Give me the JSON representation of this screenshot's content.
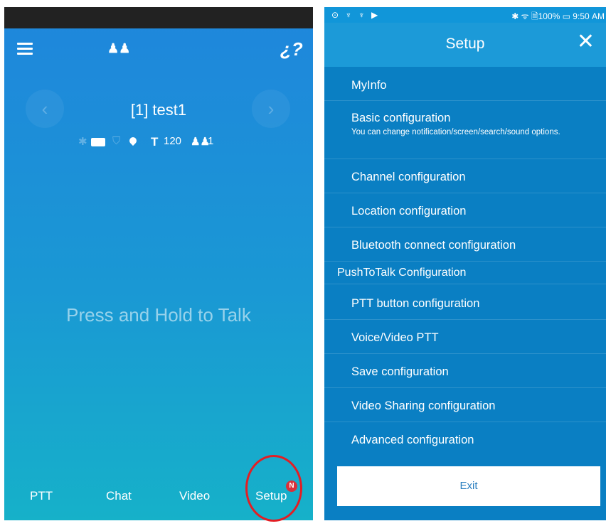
{
  "left": {
    "channel_title": "[1] test1",
    "talk_prompt": "Press and Hold to Talk",
    "status": {
      "text_icon": "T",
      "count_a": "120",
      "count_b": "1"
    },
    "tabs": [
      {
        "label": "PTT"
      },
      {
        "label": "Chat"
      },
      {
        "label": "Video"
      },
      {
        "label": "Setup"
      }
    ],
    "setup_badge": "N",
    "icons": [
      "menu-icon",
      "contacts-icon",
      "unlink-icon",
      "bluetooth-icon",
      "recorder-icon",
      "shield-icon",
      "location-icon",
      "text-icon",
      "group-icon",
      "chevron-left-icon",
      "chevron-right-icon"
    ],
    "colors": {
      "highlight_ring": "#e31e24",
      "badge": "#d8303a"
    }
  },
  "right": {
    "statusbar": {
      "left": "⊙ ♆ ♆ ▶",
      "right": "✱ ᯤ 🗎100% ▭ 9:50 AM"
    },
    "title": "Setup",
    "close_glyph": "✕",
    "items": [
      {
        "label": "MyInfo"
      },
      {
        "label": "Basic configuration",
        "sub": "You can change notification/screen/search/sound options."
      },
      {
        "label": "Channel configuration"
      },
      {
        "label": "Location configuration"
      },
      {
        "label": "Bluetooth connect configuration"
      }
    ],
    "section": "PushToTalk Configuration",
    "ptt_items": [
      {
        "label": "PTT button configuration"
      },
      {
        "label": "Voice/Video PTT"
      },
      {
        "label": "Save configuration"
      },
      {
        "label": "Video Sharing configuration"
      },
      {
        "label": "Advanced configuration"
      }
    ],
    "exit_label": "Exit",
    "colors": {
      "menu_bg": "#0a7fc3",
      "header_bg": "#1c9ad8"
    }
  }
}
